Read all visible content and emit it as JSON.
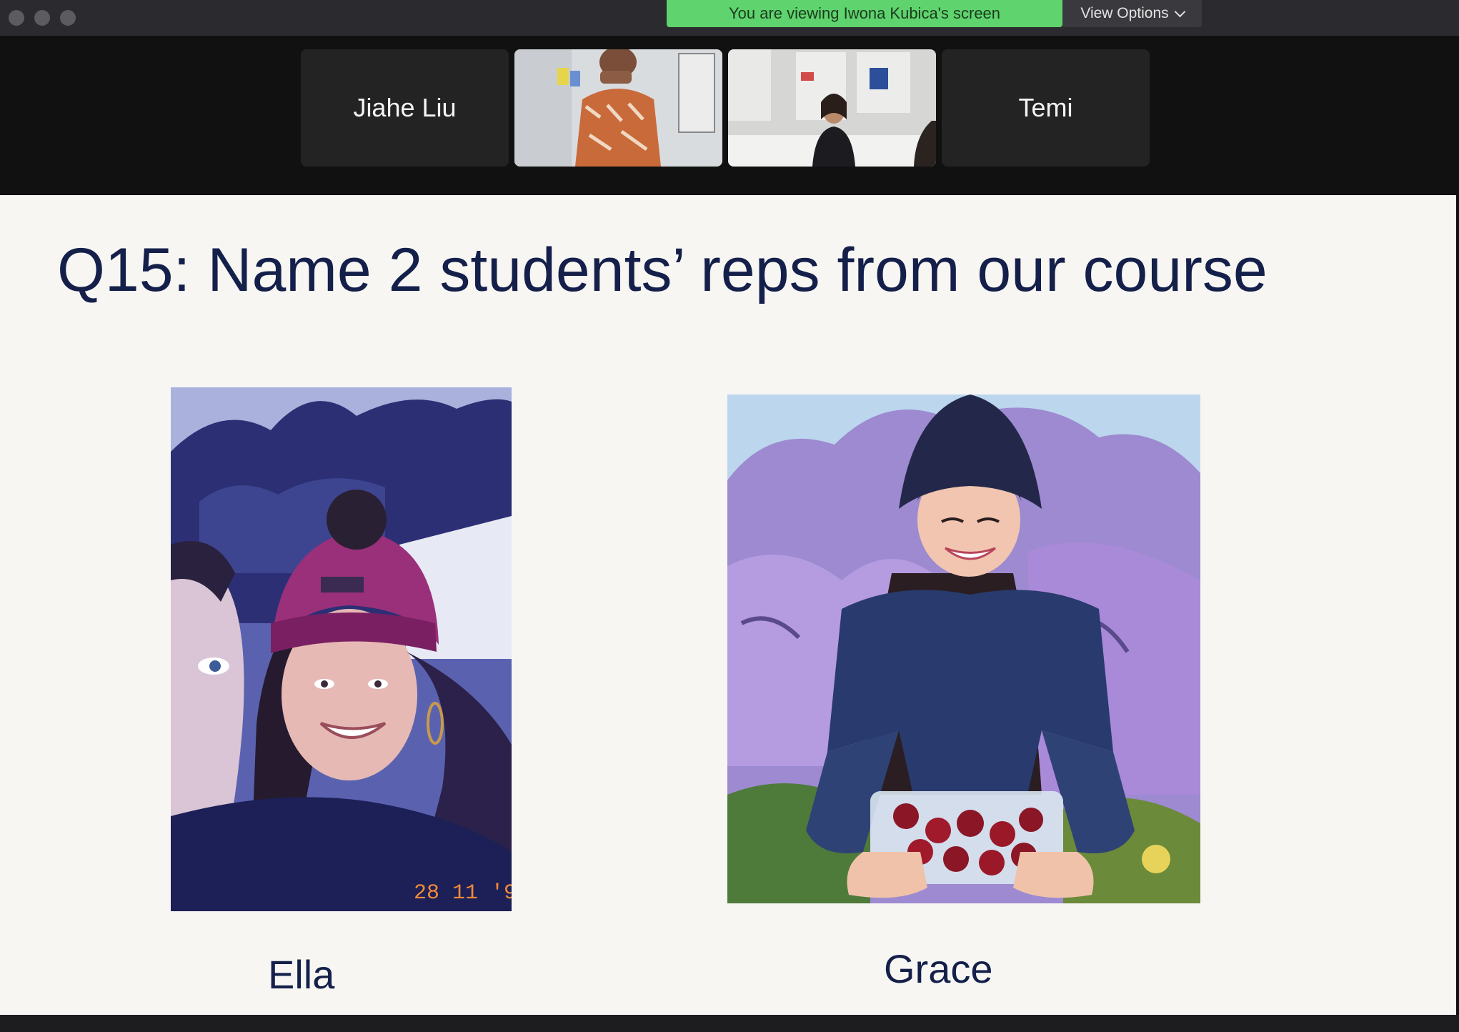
{
  "banner": {
    "sharing_text": "You are viewing Iwona Kubica's screen",
    "view_options_label": "View Options"
  },
  "gallery": {
    "participants": [
      {
        "name": "Jiahe Liu",
        "video": false
      },
      {
        "name": "",
        "video": true,
        "active_speaker": true
      },
      {
        "name": "",
        "video": true
      },
      {
        "name": "Temi",
        "video": false
      }
    ]
  },
  "slide": {
    "title": "Q15: Name 2 students’ reps from our course",
    "photos": [
      {
        "caption": "Ella",
        "date_stamp": "28 11 '9"
      },
      {
        "caption": "Grace"
      }
    ]
  },
  "colors": {
    "share_banner": "#5fd36d",
    "active_speaker_border": "#63d86a",
    "title_text": "#14204a",
    "slide_background": "#f7f6f3"
  }
}
